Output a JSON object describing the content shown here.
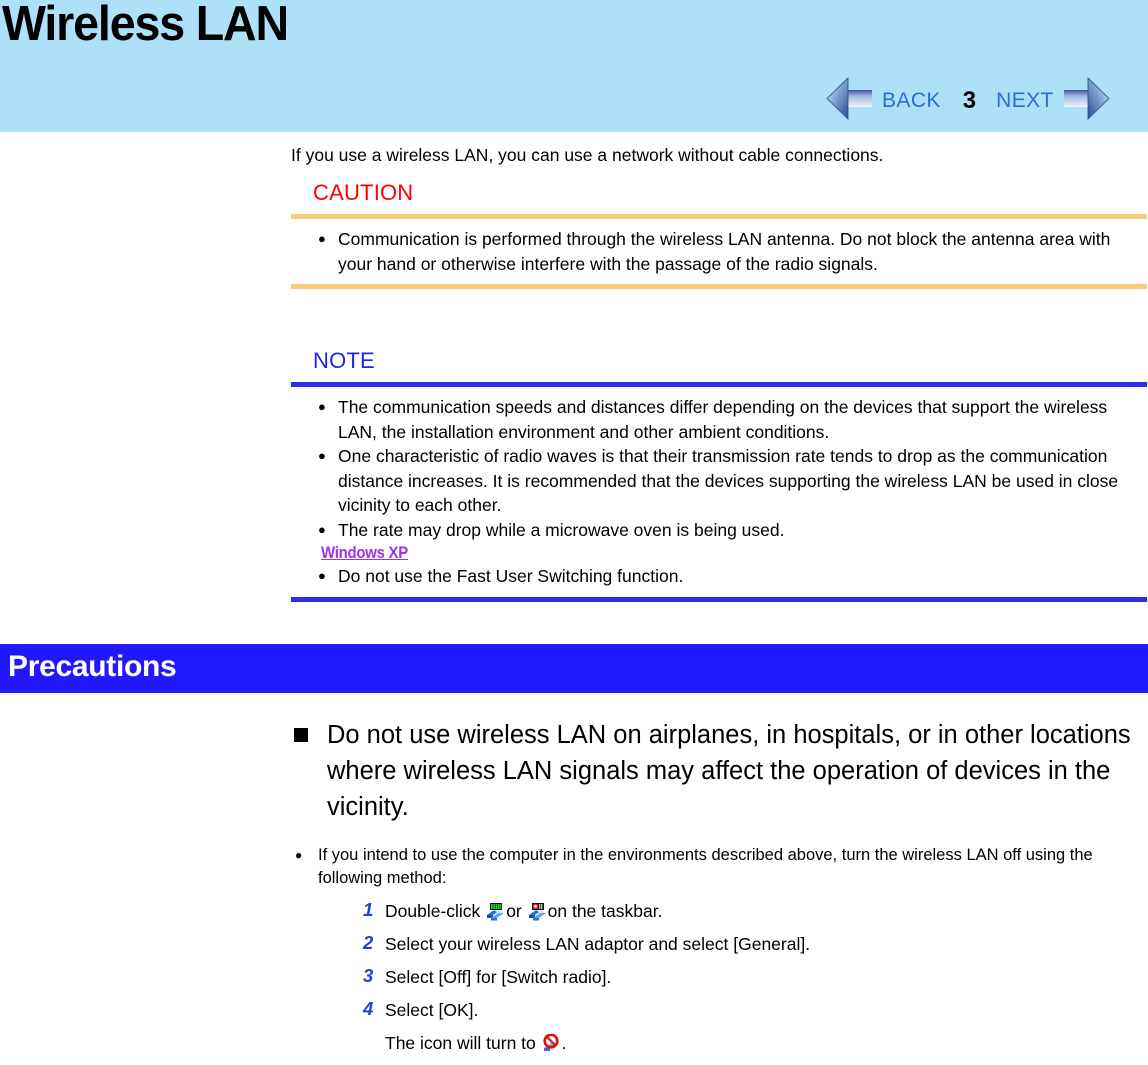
{
  "header": {
    "title": "Wireless LAN",
    "band_color": "#ade1f8"
  },
  "nav": {
    "back_label": "BACK",
    "next_label": "NEXT",
    "page_number": "3",
    "back_icon": "left-arrow-icon",
    "next_icon": "right-arrow-icon",
    "link_color": "#2a6fd6"
  },
  "intro": {
    "text": "If you use a wireless LAN, you can use a network without cable connections."
  },
  "caution": {
    "heading": "CAUTION",
    "heading_color": "#ff0000",
    "rule_color": "#fbc87e",
    "bullets": [
      "Communication is performed through the wireless LAN antenna.  Do not block the antenna area with your hand or otherwise interfere with the passage of the radio signals."
    ]
  },
  "note": {
    "heading": "NOTE",
    "heading_color": "#1b2ae0",
    "rule_color": "#2d2de8",
    "bullets": [
      "The communication speeds and distances differ depending on the devices that support the wireless LAN, the installation environment and other ambient conditions.",
      "One characteristic of radio waves is that their transmission rate tends to drop as the communication distance increases.  It is recommended that the devices supporting the wireless LAN be used in close vicinity to each other.",
      "The rate may drop while a microwave oven is being used."
    ],
    "os_tag": "Windows XP",
    "os_tag_color": "#9b30ee",
    "os_bullets": [
      "Do not use the Fast User Switching function."
    ]
  },
  "precautions": {
    "bar_title": "Precautions",
    "bar_color": "#2218fc",
    "heading": "Do not use wireless LAN on airplanes, in hospitals, or in other locations where wireless LAN signals may affect the operation of devices in the vicinity.",
    "lead_bullet": "If you intend to use the computer in the environments described above, turn the wireless LAN off using the following method:",
    "steps": [
      {
        "number": "1",
        "text_before": "Double-click",
        "icon_a": "wireless-lan-active-icon",
        "text_middle": "or",
        "icon_b": "wireless-lan-alert-icon",
        "text_after": "on the taskbar."
      },
      {
        "number": "2",
        "text": "Select your wireless LAN adaptor and select [General]."
      },
      {
        "number": "3",
        "text": "Select [Off] for [Switch radio]."
      },
      {
        "number": "4",
        "text": "Select [OK]."
      }
    ],
    "substep": {
      "text_before": "The icon will turn to",
      "icon": "wireless-lan-disabled-icon",
      "text_after": "."
    },
    "step_number_color": "#1f3fd0"
  }
}
